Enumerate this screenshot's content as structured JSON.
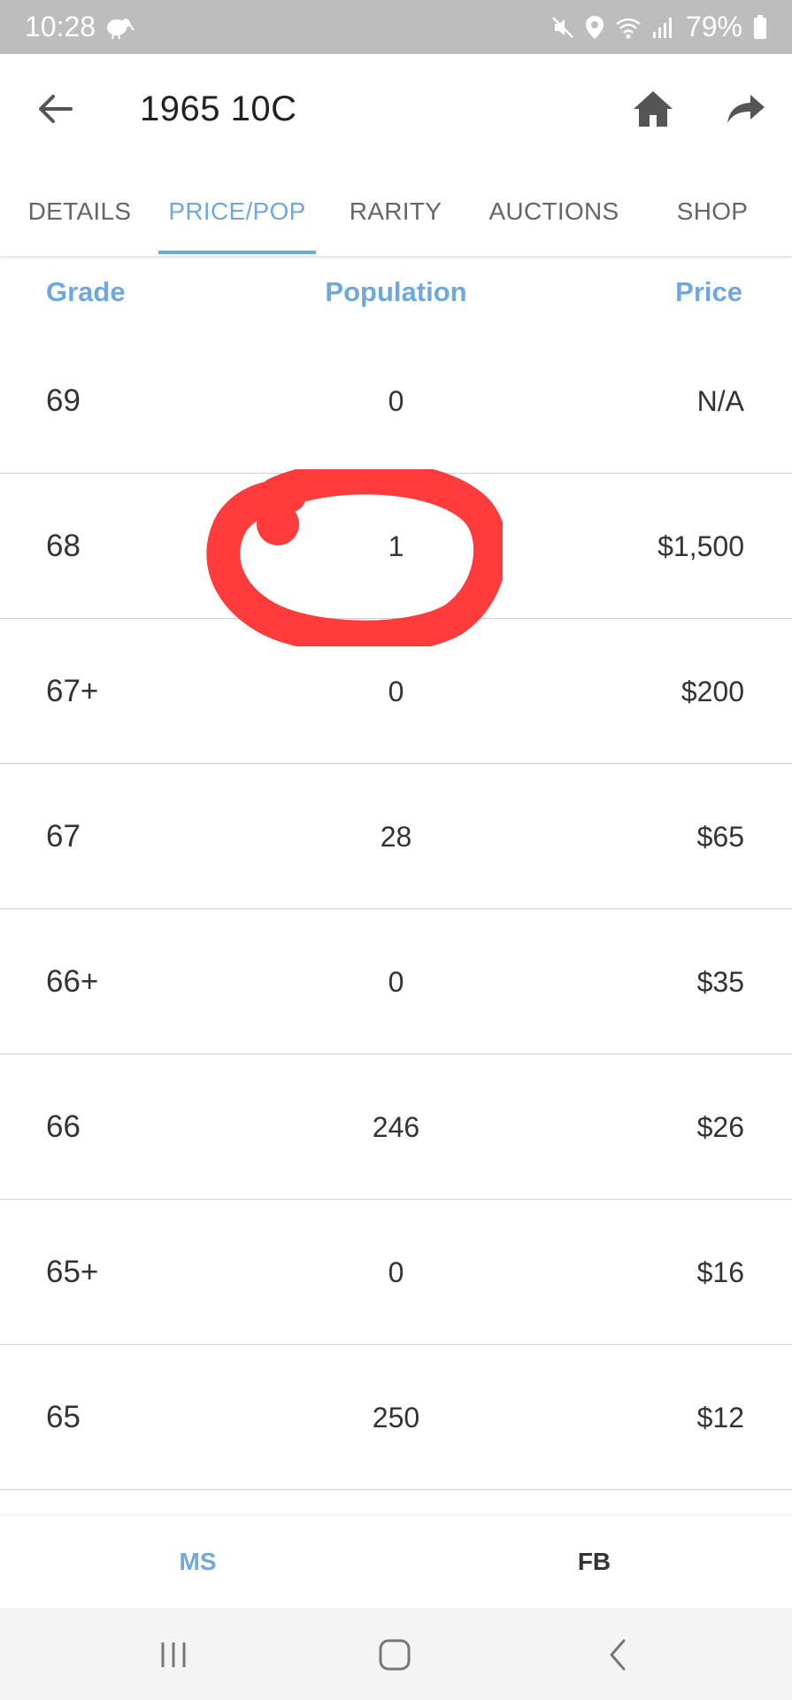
{
  "status_bar": {
    "time": "10:28",
    "battery": "79%",
    "icons": [
      "kiwi-icon",
      "mute-icon",
      "location-icon",
      "wifi-icon",
      "signal-icon",
      "battery-icon"
    ]
  },
  "header": {
    "title": "1965 10C",
    "icons": [
      "back-arrow-icon",
      "home-icon",
      "share-icon"
    ]
  },
  "tabs": [
    {
      "label": "DETAILS",
      "active": false
    },
    {
      "label": "PRICE/POP",
      "active": true
    },
    {
      "label": "RARITY",
      "active": false
    },
    {
      "label": "AUCTIONS",
      "active": false
    },
    {
      "label": "SHOP",
      "active": false
    }
  ],
  "table": {
    "columns": [
      "Grade",
      "Population",
      "Price"
    ],
    "rows": [
      {
        "grade": "69",
        "population": "0",
        "price": "N/A"
      },
      {
        "grade": "68",
        "population": "1",
        "price": "$1,500"
      },
      {
        "grade": "67+",
        "population": "0",
        "price": "$200"
      },
      {
        "grade": "67",
        "population": "28",
        "price": "$65"
      },
      {
        "grade": "66+",
        "population": "0",
        "price": "$35"
      },
      {
        "grade": "66",
        "population": "246",
        "price": "$26"
      },
      {
        "grade": "65+",
        "population": "0",
        "price": "$16"
      },
      {
        "grade": "65",
        "population": "250",
        "price": "$12"
      }
    ]
  },
  "annotation": {
    "color": "#ff3b3b",
    "shape": "hand-drawn-circle"
  },
  "bottom_toggle": [
    {
      "label": "MS",
      "active": true
    },
    {
      "label": "FB",
      "active": false
    }
  ],
  "colors": {
    "accent": "#6fa8dc",
    "status_bar": "#bdbdbd",
    "divider": "#cfcfcf"
  }
}
